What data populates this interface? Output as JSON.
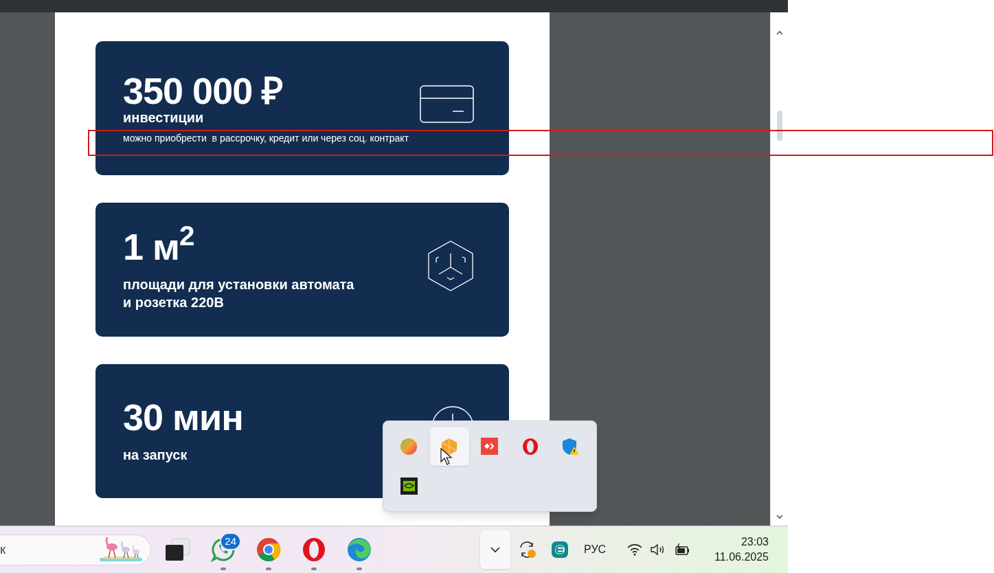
{
  "cards": [
    {
      "kind": "card",
      "title": "350 000 ₽",
      "subtitle": "инвестиции",
      "note": "можно приобрести  в рассрочку, кредит или через соц. контракт"
    },
    {
      "kind": "cube",
      "title": "1 м$^{2}$",
      "subtitle": "площади для установки автомата\nи розетка 220В"
    },
    {
      "kind": "clock",
      "title": "30 мин",
      "subtitle": "на запуск"
    }
  ],
  "tray_popup": {
    "icons": [
      {
        "kind": "ball",
        "hovered": false
      },
      {
        "kind": "orange",
        "hovered": true
      },
      {
        "kind": "anydesk",
        "hovered": false
      },
      {
        "kind": "opera",
        "hovered": false
      },
      {
        "kind": "shield",
        "hovered": false
      },
      {
        "kind": "nvidia",
        "hovered": false
      }
    ]
  },
  "taskbar": {
    "search": {
      "placeholder": "к"
    },
    "apps": [
      {
        "kind": "taskview",
        "running": false
      },
      {
        "kind": "whatsapp",
        "running": true,
        "badge": "24"
      },
      {
        "kind": "chrome",
        "running": true
      },
      {
        "kind": "opera",
        "running": true
      },
      {
        "kind": "edge",
        "running": true
      }
    ],
    "tray": {
      "language": "РУС",
      "time": "23:03",
      "date": "11.06.2025"
    }
  }
}
